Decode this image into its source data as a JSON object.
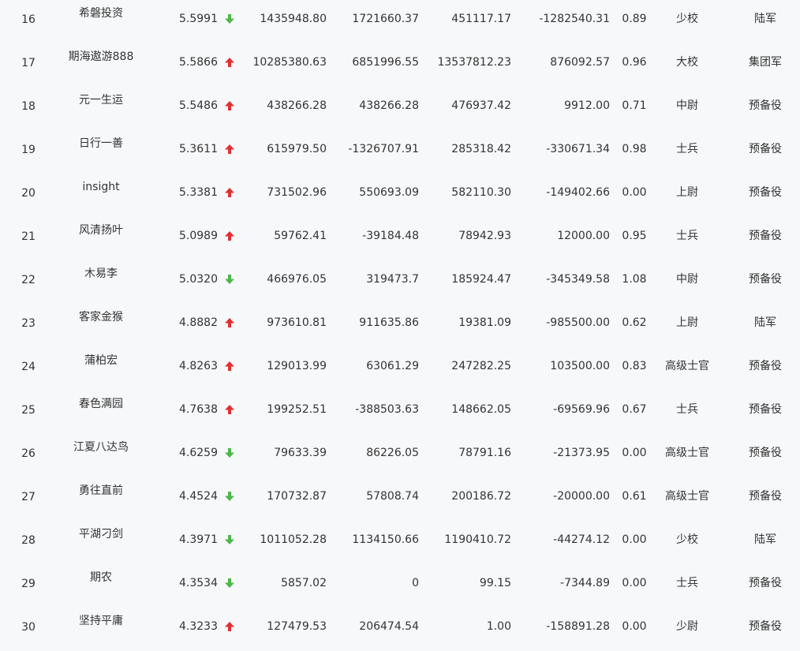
{
  "colors": {
    "up": "#e03131",
    "down": "#4cb848",
    "text": "#333333",
    "background": "#f7f8fa"
  },
  "rows": [
    {
      "rank": "16",
      "name": "希磐投资",
      "score": "5.5991",
      "trend": "down",
      "v1": "1435948.80",
      "v2": "1721660.37",
      "v3": "451117.17",
      "v4": "-1282540.31",
      "ratio": "0.89",
      "title": "少校",
      "branch": "陆军"
    },
    {
      "rank": "17",
      "name": "期海遨游888",
      "score": "5.5866",
      "trend": "up",
      "v1": "10285380.63",
      "v2": "6851996.55",
      "v3": "13537812.23",
      "v4": "876092.57",
      "ratio": "0.96",
      "title": "大校",
      "branch": "集团军"
    },
    {
      "rank": "18",
      "name": "元一生运",
      "score": "5.5486",
      "trend": "up",
      "v1": "438266.28",
      "v2": "438266.28",
      "v3": "476937.42",
      "v4": "9912.00",
      "ratio": "0.71",
      "title": "中尉",
      "branch": "预备役"
    },
    {
      "rank": "19",
      "name": "日行一善",
      "score": "5.3611",
      "trend": "up",
      "v1": "615979.50",
      "v2": "-1326707.91",
      "v3": "285318.42",
      "v4": "-330671.34",
      "ratio": "0.98",
      "title": "士兵",
      "branch": "预备役"
    },
    {
      "rank": "20",
      "name": "insight",
      "score": "5.3381",
      "trend": "up",
      "v1": "731502.96",
      "v2": "550693.09",
      "v3": "582110.30",
      "v4": "-149402.66",
      "ratio": "0.00",
      "title": "上尉",
      "branch": "预备役"
    },
    {
      "rank": "21",
      "name": "风清扬叶",
      "score": "5.0989",
      "trend": "up",
      "v1": "59762.41",
      "v2": "-39184.48",
      "v3": "78942.93",
      "v4": "12000.00",
      "ratio": "0.95",
      "title": "士兵",
      "branch": "预备役"
    },
    {
      "rank": "22",
      "name": "木易李",
      "score": "5.0320",
      "trend": "down",
      "v1": "466976.05",
      "v2": "319473.7",
      "v3": "185924.47",
      "v4": "-345349.58",
      "ratio": "1.08",
      "title": "中尉",
      "branch": "预备役"
    },
    {
      "rank": "23",
      "name": "客家金猴",
      "score": "4.8882",
      "trend": "up",
      "v1": "973610.81",
      "v2": "911635.86",
      "v3": "19381.09",
      "v4": "-985500.00",
      "ratio": "0.62",
      "title": "上尉",
      "branch": "陆军"
    },
    {
      "rank": "24",
      "name": "蒲柏宏",
      "score": "4.8263",
      "trend": "up",
      "v1": "129013.99",
      "v2": "63061.29",
      "v3": "247282.25",
      "v4": "103500.00",
      "ratio": "0.83",
      "title": "高级士官",
      "branch": "预备役"
    },
    {
      "rank": "25",
      "name": "春色满园",
      "score": "4.7638",
      "trend": "up",
      "v1": "199252.51",
      "v2": "-388503.63",
      "v3": "148662.05",
      "v4": "-69569.96",
      "ratio": "0.67",
      "title": "士兵",
      "branch": "预备役"
    },
    {
      "rank": "26",
      "name": "江夏八达鸟",
      "score": "4.6259",
      "trend": "down",
      "v1": "79633.39",
      "v2": "86226.05",
      "v3": "78791.16",
      "v4": "-21373.95",
      "ratio": "0.00",
      "title": "高级士官",
      "branch": "预备役"
    },
    {
      "rank": "27",
      "name": "勇往直前",
      "score": "4.4524",
      "trend": "down",
      "v1": "170732.87",
      "v2": "57808.74",
      "v3": "200186.72",
      "v4": "-20000.00",
      "ratio": "0.61",
      "title": "高级士官",
      "branch": "预备役"
    },
    {
      "rank": "28",
      "name": "平湖刁剑",
      "score": "4.3971",
      "trend": "down",
      "v1": "1011052.28",
      "v2": "1134150.66",
      "v3": "1190410.72",
      "v4": "-44274.12",
      "ratio": "0.00",
      "title": "少校",
      "branch": "陆军"
    },
    {
      "rank": "29",
      "name": "期农",
      "score": "4.3534",
      "trend": "down",
      "v1": "5857.02",
      "v2": "0",
      "v3": "99.15",
      "v4": "-7344.89",
      "ratio": "0.00",
      "title": "士兵",
      "branch": "预备役"
    },
    {
      "rank": "30",
      "name": "坚持平庸",
      "score": "4.3233",
      "trend": "up",
      "v1": "127479.53",
      "v2": "206474.54",
      "v3": "1.00",
      "v4": "-158891.28",
      "ratio": "0.00",
      "title": "少尉",
      "branch": "预备役"
    }
  ]
}
